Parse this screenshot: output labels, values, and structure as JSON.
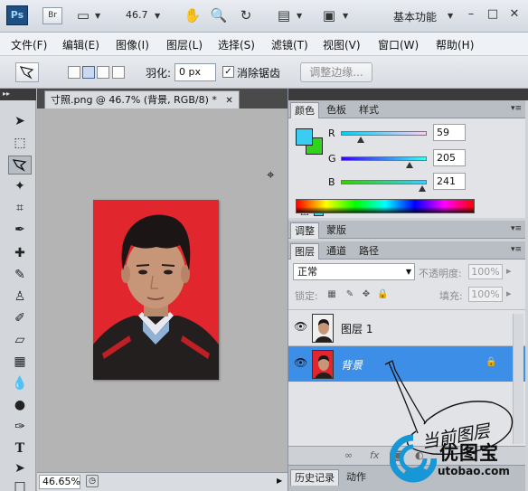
{
  "app": {
    "logo": "Ps",
    "bridge": "Br",
    "zoom_value": "46.7",
    "workspace": "基本功能"
  },
  "menu": [
    "文件(F)",
    "编辑(E)",
    "图像(I)",
    "图层(L)",
    "选择(S)",
    "滤镜(T)",
    "视图(V)",
    "窗口(W)",
    "帮助(H)"
  ],
  "options": {
    "feather_label": "羽化:",
    "feather_value": "0 px",
    "antialias_label": "消除锯齿",
    "antialias_checked": true,
    "refine_edge": "调整边缘..."
  },
  "document": {
    "tab_title": "寸照.png @ 46.7% (背景, RGB/8) *",
    "zoom_status": "46.65%"
  },
  "color_panel": {
    "tabs": [
      "颜色",
      "色板",
      "样式"
    ],
    "active_tab": "颜色",
    "foreground": "#3bcdf1",
    "background": "#32d21c",
    "channels": [
      {
        "label": "R",
        "value": "59",
        "fraction": 0.23
      },
      {
        "label": "G",
        "value": "205",
        "fraction": 0.8
      },
      {
        "label": "B",
        "value": "241",
        "fraction": 0.945
      }
    ]
  },
  "adjust_panel": {
    "tabs": [
      "调整",
      "蒙版"
    ],
    "active_tab": "调整"
  },
  "layers_panel": {
    "tabs": [
      "图层",
      "通道",
      "路径"
    ],
    "active_tab": "图层",
    "blend_mode": "正常",
    "opacity_label": "不透明度:",
    "opacity_value": "100%",
    "lock_label": "锁定:",
    "fill_label": "填充:",
    "fill_value": "100%",
    "layers": [
      {
        "name": "图层 1",
        "selected": false,
        "locked": false
      },
      {
        "name": "背景",
        "selected": true,
        "locked": true
      }
    ]
  },
  "bottom_panel": {
    "tabs": [
      "历史记录",
      "动作"
    ],
    "active_tab": "历史记录"
  },
  "annotation": "当前图层",
  "watermark": {
    "text": "优图宝",
    "url": "utobao.com"
  }
}
